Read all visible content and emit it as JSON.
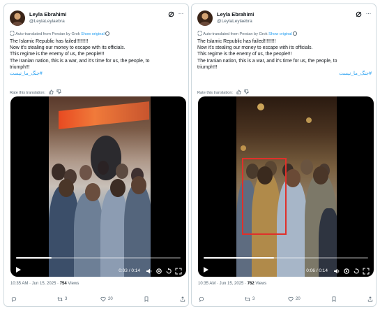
{
  "tweets": [
    {
      "author_name": "Leyla Ebrahimi",
      "author_handle": "@LeylaLeylaebra",
      "translation_notice": "Auto-translated from Persian by Grok",
      "show_original": "Show original",
      "text_lines": [
        "The Islamic Republic has failed!!!!!!!!!",
        "Now it's stealing our money to escape with its officials.",
        "This regime is the enemy of us, the people!!!",
        "The Iranian nation, this is a war, and it's time for us, the people, to",
        "triumph!!!"
      ],
      "hashtag": "#جنگ_ما_نیست",
      "rate_label": "Rate this translation:",
      "video": {
        "elapsed": "0:03",
        "total": "0:14",
        "time_text": "0:03 / 0:14",
        "progress": 0.214
      },
      "timestamp": "10:35 AM · Jun 15, 2025 ·",
      "views_count": "754",
      "views_label": "Views",
      "retweets": "3",
      "likes": "20"
    },
    {
      "author_name": "Leyla Ebrahimi",
      "author_handle": "@LeylaLeylaebra",
      "translation_notice": "Auto-translated from Persian by Grok",
      "show_original": "Show original",
      "text_lines": [
        "The Islamic Republic has failed!!!!!!!!!",
        "Now it's stealing our money to escape with its officials.",
        "This regime is the enemy of us, the people!!!",
        "The Iranian nation, this is a war, and it's time for us, the people, to",
        "triumph!!!"
      ],
      "hashtag": "#جنگ_ما_نیست",
      "rate_label": "Rate this translation:",
      "video": {
        "elapsed": "0:06",
        "total": "0:14",
        "time_text": "0:06 / 0:14",
        "progress": 0.43
      },
      "timestamp": "10:35 AM · Jun 15, 2025 ·",
      "views_count": "762",
      "views_label": "Views",
      "retweets": "3",
      "likes": "20"
    }
  ],
  "icons": [
    "grok-icon",
    "more-icon",
    "translate-icon",
    "info-icon",
    "thumbs-up-icon",
    "thumbs-down-icon",
    "play-icon",
    "volume-icon",
    "settings-icon",
    "replay-icon",
    "fullscreen-icon",
    "reply-icon",
    "retweet-icon",
    "like-icon",
    "bookmark-icon",
    "share-icon"
  ],
  "colors": {
    "link": "#1d9bf0",
    "muted": "#536471",
    "text": "#0f1419",
    "border": "#cfd9de",
    "highlight_box": "#e0302a"
  }
}
